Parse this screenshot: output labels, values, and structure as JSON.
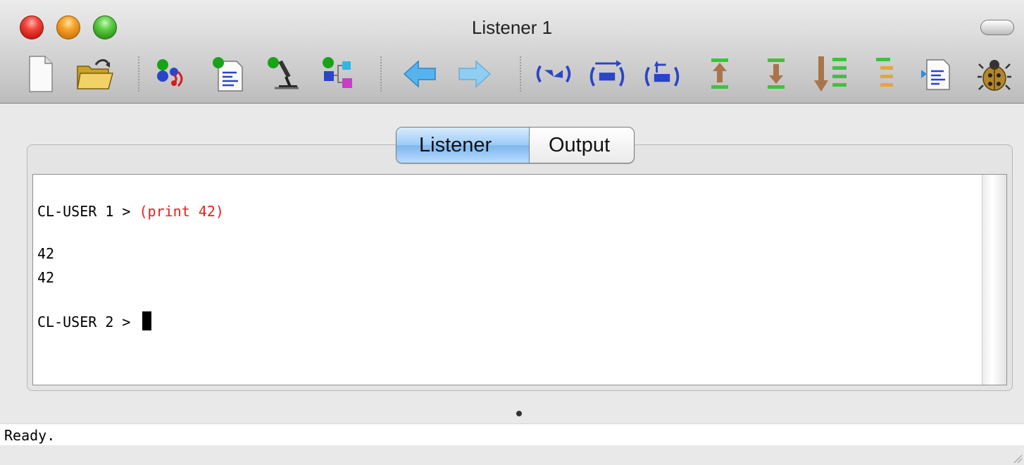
{
  "window": {
    "title": "Listener 1"
  },
  "toolbar": {
    "buttons": [
      {
        "name": "new-file-icon"
      },
      {
        "name": "open-folder-icon"
      },
      {
        "name": "processes-icon"
      },
      {
        "name": "editor-icon"
      },
      {
        "name": "inspector-icon"
      },
      {
        "name": "class-browser-icon"
      },
      {
        "name": "back-arrow-icon"
      },
      {
        "name": "forward-arrow-icon"
      },
      {
        "name": "evaluate-icon"
      },
      {
        "name": "macroexpand-icon"
      },
      {
        "name": "return-value-icon"
      },
      {
        "name": "frame-up-icon"
      },
      {
        "name": "frame-down-icon"
      },
      {
        "name": "backtrace-icon"
      },
      {
        "name": "locals-icon"
      },
      {
        "name": "find-source-icon"
      },
      {
        "name": "debugger-bug-icon"
      }
    ]
  },
  "tabs": [
    {
      "label": "Listener",
      "active": true
    },
    {
      "label": "Output",
      "active": false
    }
  ],
  "listener": {
    "prompt1": "CL-USER 1 > ",
    "input1": "(print 42)",
    "output1": "42",
    "output2": "42",
    "prompt2": "CL-USER 2 > "
  },
  "colors": {
    "input": "#e8201c",
    "active_tab": "#8fc1f3"
  },
  "status": {
    "text": "Ready."
  }
}
